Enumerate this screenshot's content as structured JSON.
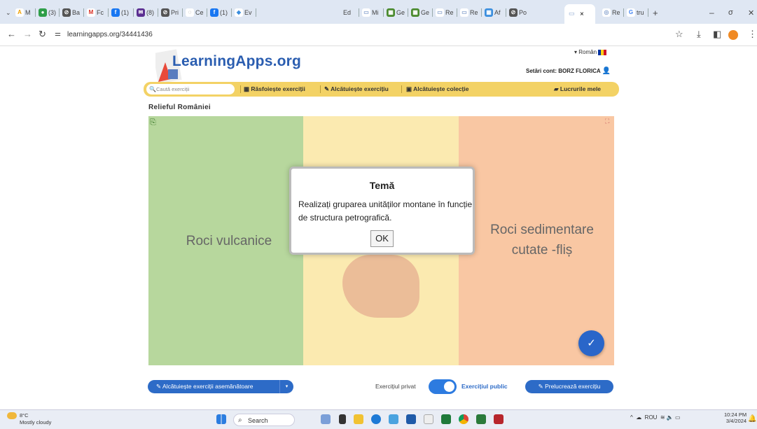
{
  "browser": {
    "tabs": [
      "M",
      "(3)",
      "Ba",
      "Fc",
      "(1)",
      "(8)",
      "Pri",
      "Ce",
      "(1)",
      "Ev",
      "Ed",
      "Mi",
      "Ge",
      "Ge",
      "Re",
      "Re",
      "Af",
      "Po",
      "Re",
      "tru"
    ],
    "active_tab_close": "×",
    "new_tab": "+",
    "url": "learningapps.org/34441436"
  },
  "site": {
    "logo": "LearningApps.org",
    "language": "Român",
    "account": "Setări cont: BORZ FLORICA",
    "search_placeholder": "Caută exerciții",
    "nav": {
      "browse": "Răsfoiește exerciții",
      "create": "Alcătuiește exercițiu",
      "collection": "Alcătuiește colecție",
      "my_work": "Lucrurile mele"
    }
  },
  "exercise": {
    "title": "Relieful României",
    "columns": [
      "Roci vulcanice",
      "",
      "Roci sedimentare cutate -fliș"
    ]
  },
  "modal": {
    "title": "Temă",
    "text": "Realizați gruparea unităților montane în funcție de structura petrografică.",
    "ok": "OK"
  },
  "footer": {
    "similar": "Alcătuiește exerciții asemănătoare",
    "private": "Exercițiul privat",
    "public": "Exercițiul public",
    "edit": "Prelucrează exercițiu"
  },
  "taskbar": {
    "temp": "8°C",
    "weather": "Mostly cloudy",
    "search": "Search",
    "lang": "ROU",
    "time": "10:24 PM",
    "date": "3/4/2024"
  }
}
